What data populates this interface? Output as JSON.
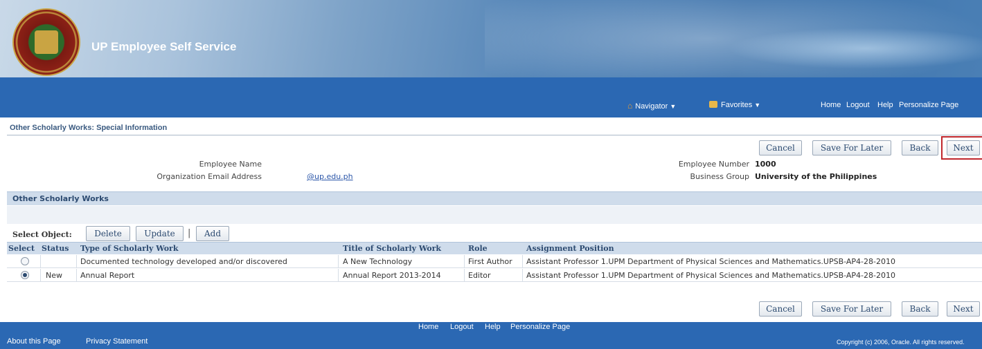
{
  "header": {
    "app_title": "UP Employee Self Service",
    "seal_text": {
      "top": "OF THE",
      "left": "UNIVERSITY",
      "right": "PHILIPPINES",
      "year": "1908"
    }
  },
  "nav": {
    "navigator_label": "Navigator",
    "favorites_label": "Favorites",
    "home_label": "Home",
    "logout_label": "Logout",
    "help_label": "Help",
    "personalize_label": "Personalize Page"
  },
  "page": {
    "title": "Other Scholarly Works: Special Information"
  },
  "buttons": {
    "cancel": "Cancel",
    "save_for_later": "Save For Later",
    "back": "Back",
    "next": "Next"
  },
  "employee": {
    "name_label": "Employee Name",
    "name_value": "",
    "email_label": "Organization Email Address",
    "email_value": "@up.edu.ph",
    "number_label": "Employee Number",
    "number_value": "1000",
    "business_group_label": "Business Group",
    "business_group_value": "University of the Philippines"
  },
  "section": {
    "title": "Other Scholarly Works",
    "select_object_label": "Select Object:",
    "delete_label": "Delete",
    "update_label": "Update",
    "separator": "|",
    "add_label": "Add"
  },
  "table": {
    "headers": [
      "Select",
      "Status",
      "Type of Scholarly Work",
      "Title of Scholarly Work",
      "Role",
      "Assignment Position"
    ],
    "rows": [
      {
        "selected": false,
        "status": "",
        "type": "Documented technology developed and/or discovered",
        "title": "A New Technology",
        "role": "First Author",
        "assignment": "Assistant Professor 1.UPM Department of Physical Sciences and Mathematics.UPSB-AP4-28-2010"
      },
      {
        "selected": true,
        "status": "New",
        "type": "Annual Report",
        "title": "Annual Report 2013-2014",
        "role": "Editor",
        "assignment": "Assistant Professor 1.UPM Department of Physical Sciences and Mathematics.UPSB-AP4-28-2010"
      }
    ]
  },
  "footer": {
    "home_label": "Home",
    "logout_label": "Logout",
    "help_label": "Help",
    "personalize_label": "Personalize Page",
    "about_label": "About this Page",
    "privacy_label": "Privacy Statement",
    "copyright": "Copyright (c) 2006, Oracle. All rights reserved."
  },
  "colors": {
    "nav_blue": "#2b68b3",
    "section_header": "#cfdceb",
    "highlight_red": "#c0262c"
  }
}
